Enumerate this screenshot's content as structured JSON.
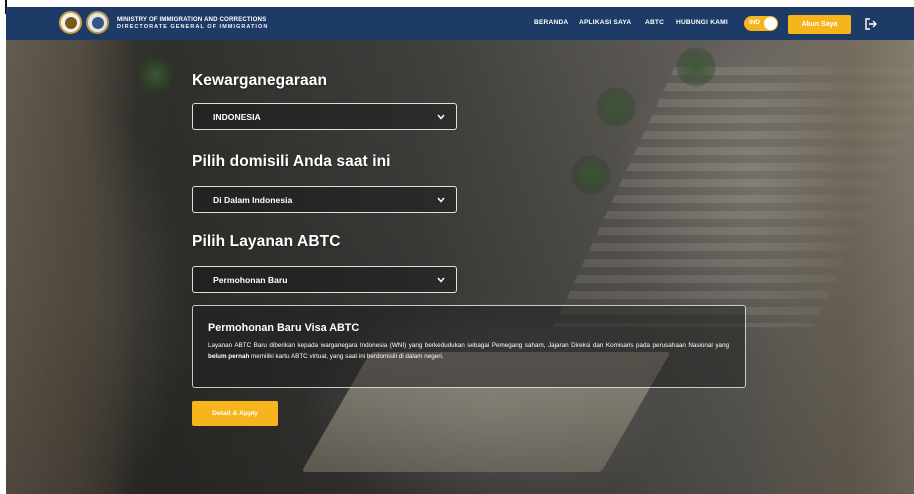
{
  "header": {
    "org_line_1": "MINISTRY OF IMMIGRATION AND CORRECTIONS",
    "org_line_2": "DIRECTORATE GENERAL OF IMMIGRATION",
    "nav": [
      "BERANDA",
      "APLIKASI SAYA",
      "ABTC",
      "HUBUNGI KAMI"
    ],
    "language": "IND",
    "account_label": "Akun Saya"
  },
  "form": {
    "citizenship": {
      "label": "Kewarganegaraan",
      "value": "INDONESIA"
    },
    "domicile": {
      "label": "Pilih domisili Anda saat ini",
      "value": "Di Dalam Indonesia"
    },
    "service": {
      "label": "Pilih Layanan ABTC",
      "value": "Permohonan Baru"
    }
  },
  "info": {
    "title": "Permohonan Baru Visa ABTC",
    "text_before": "Layanan ABTC Baru diberikan kepada warganegara Indonesia (WNI) yang berkedudukan sebagai Pemegang saham, Jajaran Direksi dan Komisaris pada perusahaan Nasional yang ",
    "text_bold": "belum pernah",
    "text_after": " memiliki kartu ABTC virtual, yang saat ini berdomisili di dalam negeri."
  },
  "action": {
    "apply_label": "Detail & Apply"
  },
  "colors": {
    "navbar": "#1e3a66",
    "accent": "#f7b51c"
  }
}
